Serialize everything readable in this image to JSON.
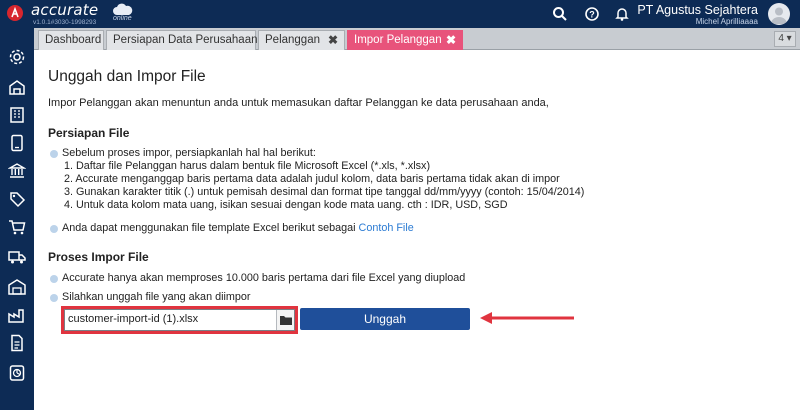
{
  "header": {
    "logo_text": "accurate",
    "logo_sub": "online",
    "version": "v1.0.1#3030-1998293",
    "company": "PT Agustus Sejahtera",
    "user": "Michel Aprilliaaaa",
    "icons": [
      "search-icon",
      "help-icon",
      "bell-icon",
      "avatar"
    ]
  },
  "sidebar": {
    "items": [
      "settings-icon",
      "company-icon",
      "building-icon",
      "phone-icon",
      "bank-icon",
      "tag-icon",
      "cart-icon",
      "truck-icon",
      "warehouse-icon",
      "factory-icon",
      "document-icon",
      "report-icon"
    ]
  },
  "tabs": [
    {
      "label": "Dashboard",
      "closable": false,
      "active": false
    },
    {
      "label": "Persiapan Data Perusahaan",
      "closable": false,
      "active": false
    },
    {
      "label": "Pelanggan",
      "closable": true,
      "active": false
    },
    {
      "label": "Impor Pelanggan",
      "closable": true,
      "active": true
    }
  ],
  "tab_close_glyph": "✖",
  "tab_count": "4",
  "main": {
    "title": "Unggah dan Impor File",
    "intro": "Impor Pelanggan akan menuntun anda untuk memasukan daftar Pelanggan ke data perusahaan anda,",
    "prep": {
      "heading": "Persiapan File",
      "bullet1": "Sebelum proses impor, persiapkanlah hal hal berikut:",
      "steps": [
        "1. Daftar file Pelanggan harus dalam bentuk file Microsoft Excel (*.xls, *.xlsx)",
        "2. Accurate menganggap baris pertama data adalah judul kolom, data baris pertama tidak akan di impor",
        "3. Gunakan karakter titik (.) untuk pemisah desimal dan format tipe tanggal dd/mm/yyyy (contoh: 15/04/2014)",
        "4. Untuk data kolom mata uang, isikan sesuai dengan kode mata uang. cth : IDR, USD, SGD"
      ],
      "template_text": "Anda dapat menggunakan file template Excel berikut sebagai ",
      "template_link": "Contoh File"
    },
    "process": {
      "heading": "Proses Impor File",
      "bullet1": "Accurate hanya akan memproses 10.000 baris pertama dari file Excel yang diupload",
      "bullet2": "Silahkan unggah file yang akan diimpor"
    },
    "file_value": "customer-import-id (1).xlsx",
    "upload_label": "Unggah"
  },
  "colors": {
    "navy": "#0d2b55",
    "active_tab": "#e8537b",
    "button": "#1f4f9a",
    "highlight": "#e0343f",
    "link": "#2b7bd3"
  }
}
